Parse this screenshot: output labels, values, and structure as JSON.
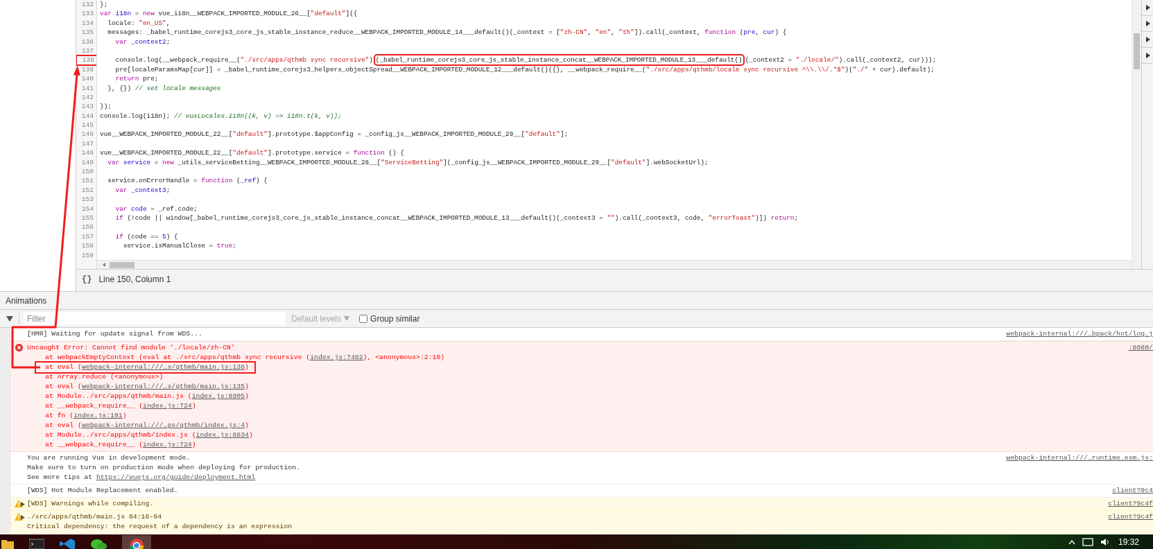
{
  "editor": {
    "lines": [
      {
        "number": "132",
        "marked": false,
        "tokens": [
          {
            "kind": "plain",
            "text": "};"
          }
        ]
      },
      {
        "number": "133",
        "marked": false,
        "tokens": [
          {
            "kind": "keyword",
            "text": "var "
          },
          {
            "kind": "def",
            "text": "i18n"
          },
          {
            "kind": "plain",
            "text": " = "
          },
          {
            "kind": "keyword",
            "text": "new"
          },
          {
            "kind": "plain",
            "text": " vue_i18n__WEBPACK_IMPORTED_MODULE_26__["
          },
          {
            "kind": "string",
            "text": "\"default\""
          },
          {
            "kind": "plain",
            "text": "]({"
          }
        ]
      },
      {
        "number": "134",
        "marked": false,
        "tokens": [
          {
            "kind": "plain",
            "text": "  locale: "
          },
          {
            "kind": "string",
            "text": "\"en_US\""
          },
          {
            "kind": "plain",
            "text": ","
          }
        ]
      },
      {
        "number": "135",
        "marked": false,
        "tokens": [
          {
            "kind": "plain",
            "text": "  messages: _babel_runtime_corejs3_core_js_stable_instance_reduce__WEBPACK_IMPORTED_MODULE_14___default()(_context = ["
          },
          {
            "kind": "string",
            "text": "\"zh-CN\""
          },
          {
            "kind": "plain",
            "text": ", "
          },
          {
            "kind": "string",
            "text": "\"en\""
          },
          {
            "kind": "plain",
            "text": ", "
          },
          {
            "kind": "string",
            "text": "\"th\""
          },
          {
            "kind": "plain",
            "text": "]).call(_context, "
          },
          {
            "kind": "keyword",
            "text": "function"
          },
          {
            "kind": "plain",
            "text": " ("
          },
          {
            "kind": "def",
            "text": "pre"
          },
          {
            "kind": "plain",
            "text": ", "
          },
          {
            "kind": "def",
            "text": "cur"
          },
          {
            "kind": "plain",
            "text": ") {"
          }
        ]
      },
      {
        "number": "136",
        "marked": false,
        "tokens": [
          {
            "kind": "keyword",
            "text": "    var "
          },
          {
            "kind": "def",
            "text": "_context2"
          },
          {
            "kind": "plain",
            "text": ";"
          }
        ]
      },
      {
        "number": "137",
        "marked": false
      },
      {
        "number": "138",
        "marked": true,
        "tokens": [
          {
            "kind": "plain",
            "text": "    console.log(__webpack_require__("
          },
          {
            "kind": "string",
            "text": "\"./src/apps/qthmb sync recursive\""
          },
          {
            "kind": "plain",
            "text": ")"
          },
          {
            "kind": "boxed",
            "text": "(_babel_runtime_corejs3_core_js_stable_instance_concat__WEBPACK_IMPORTED_MODULE_13___default()"
          },
          {
            "kind": "plain",
            "text": "(_context2 = "
          },
          {
            "kind": "string",
            "text": "\"./locale/\""
          },
          {
            "kind": "plain",
            "text": ").call(_context2, cur)));"
          }
        ]
      },
      {
        "number": "139",
        "marked": false,
        "tokens": [
          {
            "kind": "plain",
            "text": "    pre[localeParamsMap[cur]] = _babel_runtime_corejs3_helpers_objectSpread__WEBPACK_IMPORTED_MODULE_12___default()({}, __webpack_require__("
          },
          {
            "kind": "string",
            "text": "\"./src/apps/qthmb/locale sync recursive ^\\\\.\\\\/.*$\""
          },
          {
            "kind": "plain",
            "text": ")("
          },
          {
            "kind": "string",
            "text": "\"./\""
          },
          {
            "kind": "plain",
            "text": " + cur).default);"
          }
        ]
      },
      {
        "number": "140",
        "marked": false,
        "tokens": [
          {
            "kind": "keyword",
            "text": "    return"
          },
          {
            "kind": "plain",
            "text": " pre;"
          }
        ]
      },
      {
        "number": "141",
        "marked": false,
        "tokens": [
          {
            "kind": "plain",
            "text": "  }, {}) "
          },
          {
            "kind": "comment",
            "text": "// set locale messages"
          }
        ]
      },
      {
        "number": "142",
        "marked": false
      },
      {
        "number": "143",
        "marked": false,
        "tokens": [
          {
            "kind": "plain",
            "text": "});"
          }
        ]
      },
      {
        "number": "144",
        "marked": false,
        "tokens": [
          {
            "kind": "plain",
            "text": "console.log(i18n); "
          },
          {
            "kind": "comment",
            "text": "// vuxLocales.i18n((k, v) => i18n.t(k, v));"
          }
        ]
      },
      {
        "number": "145",
        "marked": false
      },
      {
        "number": "146",
        "marked": false,
        "tokens": [
          {
            "kind": "plain",
            "text": "vue__WEBPACK_IMPORTED_MODULE_22__["
          },
          {
            "kind": "string",
            "text": "\"default\""
          },
          {
            "kind": "plain",
            "text": "].prototype.$appConfig = _config_js__WEBPACK_IMPORTED_MODULE_29__["
          },
          {
            "kind": "string",
            "text": "\"default\""
          },
          {
            "kind": "plain",
            "text": "];"
          }
        ]
      },
      {
        "number": "147",
        "marked": false
      },
      {
        "number": "148",
        "marked": false,
        "tokens": [
          {
            "kind": "plain",
            "text": "vue__WEBPACK_IMPORTED_MODULE_22__["
          },
          {
            "kind": "string",
            "text": "\"default\""
          },
          {
            "kind": "plain",
            "text": "].prototype.service = "
          },
          {
            "kind": "keyword",
            "text": "function"
          },
          {
            "kind": "plain",
            "text": " () {"
          }
        ]
      },
      {
        "number": "149",
        "marked": false,
        "tokens": [
          {
            "kind": "keyword",
            "text": "  var "
          },
          {
            "kind": "def",
            "text": "service"
          },
          {
            "kind": "plain",
            "text": " = "
          },
          {
            "kind": "keyword",
            "text": "new"
          },
          {
            "kind": "plain",
            "text": " _utils_serviceBetting__WEBPACK_IMPORTED_MODULE_28__["
          },
          {
            "kind": "string",
            "text": "\"ServiceBetting\""
          },
          {
            "kind": "plain",
            "text": "](_config_js__WEBPACK_IMPORTED_MODULE_29__["
          },
          {
            "kind": "string",
            "text": "\"default\""
          },
          {
            "kind": "plain",
            "text": "].webSocketUrl);"
          }
        ]
      },
      {
        "number": "150",
        "marked": false
      },
      {
        "number": "151",
        "marked": false,
        "tokens": [
          {
            "kind": "plain",
            "text": "  service.onErrorHandle = "
          },
          {
            "kind": "keyword",
            "text": "function"
          },
          {
            "kind": "plain",
            "text": " ("
          },
          {
            "kind": "def",
            "text": "_ref"
          },
          {
            "kind": "plain",
            "text": ") {"
          }
        ]
      },
      {
        "number": "152",
        "marked": false,
        "tokens": [
          {
            "kind": "keyword",
            "text": "    var "
          },
          {
            "kind": "def",
            "text": "_context3"
          },
          {
            "kind": "plain",
            "text": ";"
          }
        ]
      },
      {
        "number": "153",
        "marked": false
      },
      {
        "number": "154",
        "marked": false,
        "tokens": [
          {
            "kind": "keyword",
            "text": "    var "
          },
          {
            "kind": "def",
            "text": "code"
          },
          {
            "kind": "plain",
            "text": " = _ref.code;"
          }
        ]
      },
      {
        "number": "155",
        "marked": false,
        "tokens": [
          {
            "kind": "keyword",
            "text": "    if"
          },
          {
            "kind": "plain",
            "text": " (!code || window[_babel_runtime_corejs3_core_js_stable_instance_concat__WEBPACK_IMPORTED_MODULE_13___default()(_context3 = "
          },
          {
            "kind": "string",
            "text": "\"\""
          },
          {
            "kind": "plain",
            "text": ").call(_context3, code, "
          },
          {
            "kind": "string",
            "text": "\"errorToast\""
          },
          {
            "kind": "plain",
            "text": ")]) "
          },
          {
            "kind": "keyword",
            "text": "return"
          },
          {
            "kind": "plain",
            "text": ";"
          }
        ]
      },
      {
        "number": "156",
        "marked": false
      },
      {
        "number": "157",
        "marked": false,
        "tokens": [
          {
            "kind": "keyword",
            "text": "    if"
          },
          {
            "kind": "plain",
            "text": " (code == "
          },
          {
            "kind": "number",
            "text": "5"
          },
          {
            "kind": "plain",
            "text": ") {"
          }
        ]
      },
      {
        "number": "158",
        "marked": false,
        "tokens": [
          {
            "kind": "plain",
            "text": "      service.isManualClose = "
          },
          {
            "kind": "keyword",
            "text": "true"
          },
          {
            "kind": "plain",
            "text": ";"
          }
        ]
      },
      {
        "number": "159",
        "marked": false
      }
    ],
    "format_button": "{}",
    "status": "Line 150, Column 1"
  },
  "annotation_arrow": true,
  "drawer": {
    "tabs": [
      {
        "label": "Animations",
        "selected": true
      }
    ]
  },
  "toolbar": {
    "filter": {
      "placeholder": "Filter"
    },
    "levels": {
      "label": "Default levels",
      "disabled": true
    },
    "group_similar": {
      "label": "Group similar",
      "checked": false
    }
  },
  "console": {
    "messages": [
      {
        "kind": "info",
        "source": "webpack-internal:///…bpack/hot/log.j",
        "lines": [
          [
            {
              "kind": "text",
              "text": "[HMR] Waiting for update signal from WDS..."
            }
          ]
        ]
      },
      {
        "kind": "error",
        "source": ":8080/",
        "lines": [
          [
            {
              "kind": "text",
              "text": "Uncaught Error: Cannot find module './locale/zh-CN'"
            }
          ]
        ],
        "stack": [
          {
            "marked": false,
            "segments": [
              {
                "kind": "text",
                "text": "at webpackEmptyContext (eval at ./src/apps/qthmb sync recursive ("
              },
              {
                "kind": "link",
                "text": "index.js:7482"
              },
              {
                "kind": "text",
                "text": "), <anonymous>:2:10)"
              }
            ]
          },
          {
            "marked": true,
            "segments": [
              {
                "kind": "text",
                "text": "at eval ("
              },
              {
                "kind": "link",
                "text": "webpack-internal:///…s/qthmb/main.js:138"
              },
              {
                "kind": "text",
                "text": ")"
              }
            ]
          },
          {
            "marked": false,
            "segments": [
              {
                "kind": "text",
                "text": "at Array.reduce (<anonymous>)"
              }
            ]
          },
          {
            "marked": false,
            "segments": [
              {
                "kind": "text",
                "text": "at eval ("
              },
              {
                "kind": "link",
                "text": "webpack-internal:///…s/qthmb/main.js:135"
              },
              {
                "kind": "text",
                "text": ")"
              }
            ]
          },
          {
            "marked": false,
            "segments": [
              {
                "kind": "text",
                "text": "at Module../src/apps/qthmb/main.js ("
              },
              {
                "kind": "link",
                "text": "index.js:8905"
              },
              {
                "kind": "text",
                "text": ")"
              }
            ]
          },
          {
            "marked": false,
            "segments": [
              {
                "kind": "text",
                "text": "at __webpack_require__ ("
              },
              {
                "kind": "link",
                "text": "index.js:724"
              },
              {
                "kind": "text",
                "text": ")"
              }
            ]
          },
          {
            "marked": false,
            "segments": [
              {
                "kind": "text",
                "text": "at fn ("
              },
              {
                "kind": "link",
                "text": "index.js:101"
              },
              {
                "kind": "text",
                "text": ")"
              }
            ]
          },
          {
            "marked": false,
            "segments": [
              {
                "kind": "text",
                "text": "at eval ("
              },
              {
                "kind": "link",
                "text": "webpack-internal:///…ps/qthmb/index.js:4"
              },
              {
                "kind": "text",
                "text": ")"
              }
            ]
          },
          {
            "marked": false,
            "segments": [
              {
                "kind": "text",
                "text": "at Module../src/apps/qthmb/index.js ("
              },
              {
                "kind": "link",
                "text": "index.js:8834"
              },
              {
                "kind": "text",
                "text": ")"
              }
            ]
          },
          {
            "marked": false,
            "segments": [
              {
                "kind": "text",
                "text": "at __webpack_require__ ("
              },
              {
                "kind": "link",
                "text": "index.js:724"
              },
              {
                "kind": "text",
                "text": ")"
              }
            ]
          }
        ]
      },
      {
        "kind": "info",
        "source": "webpack-internal:///…runtime.esm.js:",
        "lines": [
          [
            {
              "kind": "text",
              "text": "You are running Vue in development mode."
            }
          ],
          [
            {
              "kind": "text",
              "text": "Make sure to turn on production mode when deploying for production."
            }
          ],
          [
            {
              "kind": "text",
              "text": "See more tips at "
            },
            {
              "kind": "link",
              "text": "https://vuejs.org/guide/deployment.html"
            }
          ]
        ]
      },
      {
        "kind": "info",
        "source": "client?9c4",
        "lines": [
          [
            {
              "kind": "text",
              "text": "[WDS] Hot Module Replacement enabled."
            }
          ]
        ]
      },
      {
        "kind": "warning",
        "expanded": false,
        "source": "client?9c4f",
        "lines": [
          [
            {
              "kind": "text",
              "text": "[WDS] Warnings while compiling."
            }
          ]
        ]
      },
      {
        "kind": "warning",
        "expanded": false,
        "source": "client?9c4f",
        "lines": [
          [
            {
              "kind": "text",
              "text": "./src/apps/qthmb/main.js 84:16-94"
            }
          ],
          [
            {
              "kind": "text",
              "text": "Critical dependency: the request of a dependency is an expression"
            }
          ]
        ]
      }
    ]
  },
  "taskbar": {
    "clock": "19:32"
  }
}
